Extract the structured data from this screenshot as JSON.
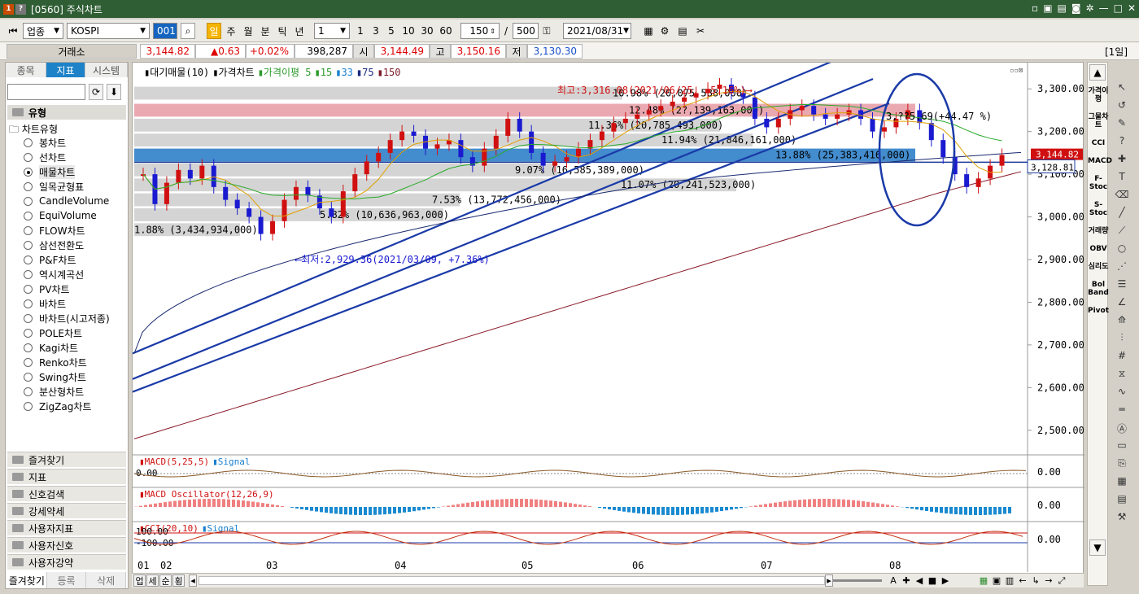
{
  "window": {
    "icon1": "1",
    "icon2": "?",
    "title": "[0560] 주식차트"
  },
  "toolbar": {
    "market_type": "업종",
    "index_name": "KOSPI",
    "code": "001",
    "periods": [
      "일",
      "주",
      "월",
      "분",
      "틱",
      "년"
    ],
    "active_period": "일",
    "interval": "1",
    "quick_counts": [
      "1",
      "3",
      "5",
      "10",
      "30",
      "60"
    ],
    "view_count": "150",
    "separator": "/",
    "total_count": "500",
    "date": "2021/08/31",
    "right_label": "[1일]"
  },
  "quote": {
    "exchange": "거래소",
    "price": "3,144.82",
    "change": "▲0.63",
    "change_pct": "+0.02%",
    "volume": "398,287",
    "open_label": "시",
    "open": "3,144.49",
    "high_label": "고",
    "high": "3,150.16",
    "low_label": "저",
    "low": "3,130.30"
  },
  "left_panel": {
    "tabs": [
      "종목",
      "지표",
      "시스템"
    ],
    "active_tab": "지표",
    "group_title": "유형",
    "tree_root": "차트유형",
    "chart_types": [
      "봉차트",
      "선차트",
      "매물차트",
      "일목균형표",
      "CandleVolume",
      "EquiVolume",
      "FLOW차트",
      "삼선전환도",
      "P&F차트",
      "역시계곡선",
      "PV차트",
      "바차트",
      "바차트(시고저종)",
      "POLE차트",
      "Kagi차트",
      "Renko차트",
      "Swing차트",
      "분산형차트",
      "ZigZag차트"
    ],
    "selected_type": "매물차트",
    "folders": [
      "즐겨찾기",
      "지표",
      "신호검색",
      "강세약세",
      "사용자지표",
      "사용자신호",
      "사용자강약"
    ],
    "bottom_tabs": [
      "즐겨찾기",
      "등록",
      "삭제"
    ]
  },
  "legend": {
    "items": [
      "대기매물(10)",
      "가격차트",
      "가격이평 5",
      "15",
      "33",
      "75",
      "150"
    ]
  },
  "chart_data": {
    "type": "line",
    "title": "",
    "y_ticks": [
      "3,300.00",
      "3,200.00",
      "3,100.00",
      "3,000.00",
      "2,900.00",
      "2,800.00",
      "2,700.00",
      "2,600.00",
      "2,500.00"
    ],
    "ylim": [
      2450,
      3350
    ],
    "x_ticks": [
      "01",
      "02",
      "03",
      "04",
      "05",
      "06",
      "07",
      "08"
    ],
    "current_price_tag": "3,144.82",
    "cursor_price_tag": "3,128.81",
    "volume_profile": [
      {
        "price": 3290,
        "label": "10.98% (20,075,588,000)",
        "highlight": "none"
      },
      {
        "price": 3250,
        "label": "12.48% (2?,139,163,000)",
        "highlight": "red"
      },
      {
        "price": 3215,
        "label": "11.36% (20,785,493,000)",
        "highlight": "none"
      },
      {
        "price": 3180,
        "label": "11.94% (21,846,161,000)",
        "highlight": "none"
      },
      {
        "price": 3145,
        "label": "13.88% (25,383,416,000)",
        "highlight": "blue"
      },
      {
        "price": 3110,
        "label": "9.07% (16,585,389,000)",
        "highlight": "none"
      },
      {
        "price": 3075,
        "label": "11.07% (20,241,523,000)",
        "highlight": "none"
      },
      {
        "price": 3040,
        "label": "7.53% (13,772,456,000)",
        "highlight": "none"
      },
      {
        "price": 3005,
        "label": "5.82% (10,636,963,000)",
        "highlight": "none"
      },
      {
        "price": 2970,
        "label": "1.88% (3,434,934,000)",
        "highlight": "none"
      }
    ],
    "annotations": {
      "high": "최고:3,316.08(2021/06/25, -5.16%)",
      "low": "최저:2,929.36(2021/03/09, +7.36%)",
      "partial": "3,??5.69(+44.47 %)"
    },
    "sub_panels": [
      {
        "name": "MACD(5,25,5)",
        "signal": "Signal",
        "value_label": "0.00",
        "left_label": "0.00"
      },
      {
        "name": "MACD Oscillator(12,26,9)",
        "value_label": "0.00"
      },
      {
        "name": "CCI(20,10)",
        "signal": "Signal",
        "value_label": "0.00",
        "left_top": "100.00",
        "left_bottom": "-100.00"
      }
    ]
  },
  "right_indicators": [
    "가격이평",
    "그물차트",
    "CCI",
    "MACD",
    "F-Stoc",
    "S-Stoc",
    "거래량",
    "OBV",
    "심리도",
    "Bol Band",
    "Pivot"
  ],
  "bottom_bar": {
    "tabs": [
      "업",
      "세",
      "순",
      "횡"
    ],
    "zoom_label": "A"
  }
}
